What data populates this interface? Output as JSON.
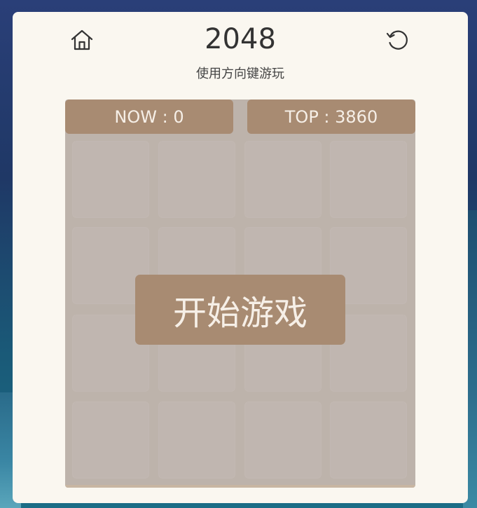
{
  "header": {
    "title": "2048",
    "subtitle": "使用方向键游玩",
    "home_icon": "home-icon",
    "restart_icon": "restart-icon"
  },
  "score": {
    "now": "NOW : 0",
    "top": "TOP : 3860"
  },
  "board": {
    "rows": 4,
    "cols": 4,
    "tiles": [
      [
        "",
        "",
        "",
        ""
      ],
      [
        "",
        "",
        "",
        ""
      ],
      [
        "",
        "",
        "",
        ""
      ],
      [
        "",
        "",
        "",
        ""
      ]
    ]
  },
  "start_button": {
    "label": "开始游戏"
  },
  "colors": {
    "card": "#faf7f0",
    "board": "#bdb3ab",
    "cell": "#c0b6b0",
    "accent": "#a88b72",
    "accent_text": "#f6efe7"
  }
}
